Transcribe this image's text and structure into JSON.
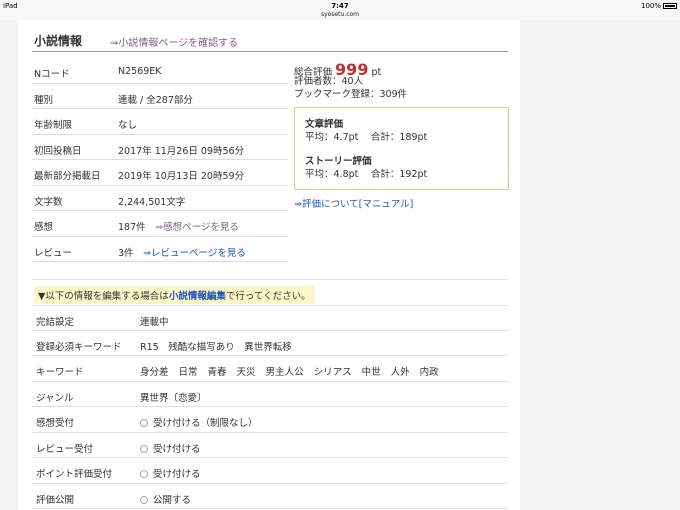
{
  "statusbar": {
    "device": "iPad",
    "time": "7:47",
    "url": "syosetu.com",
    "battery": "100%"
  },
  "header": {
    "title": "小説情報",
    "link": "⇒小説情報ページを確認する"
  },
  "info": {
    "ncode_label": "Nコード",
    "ncode": "N2569EK",
    "type_label": "種別",
    "type": "連載 / 全287部分",
    "age_label": "年齢制限",
    "age": "なし",
    "first_label": "初回投稿日",
    "first": "2017年 11月26日 09時56分",
    "latest_label": "最新部分掲載日",
    "latest": "2019年 10月13日 20時59分",
    "chars_label": "文字数",
    "chars": "2,244,501文字",
    "impressions_label": "感想",
    "impressions_count": "187件",
    "impressions_link": "⇒感想ページを見る",
    "review_label": "レビュー",
    "review_count": "3件",
    "review_link": "⇒レビューページを見る"
  },
  "stats": {
    "total_label": "総合評価",
    "total_value": "999",
    "total_unit": "pt",
    "raters": "評価者数：40人",
    "bookmarks": "ブックマーク登録：309件"
  },
  "eval": {
    "writing_title": "文章評価",
    "writing_values": "平均：4.7pt　 合計：189pt",
    "story_title": "ストーリー評価",
    "story_values": "平均：4.8pt　 合計：192pt",
    "manual_link": "⇒評価について[マニュアル]"
  },
  "edit_note": {
    "prefix": "▼以下の情報を編集する場合は",
    "link": "小説情報編集",
    "suffix": "で行ってください。"
  },
  "settings": {
    "completion_label": "完結設定",
    "completion": "連載中",
    "required_kw_label": "登録必須キーワード",
    "required_kw": "R15　残酷な描写あり　異世界転移",
    "keywords_label": "キーワード",
    "keywords": [
      "身分差",
      "日常",
      "青春",
      "天災",
      "男主人公",
      "シリアス",
      "中世",
      "人外",
      "内政"
    ],
    "genre_label": "ジャンル",
    "genre": "異世界〔恋愛〕",
    "impressions_accept_label": "感想受付",
    "impressions_accept": "受け付ける（制限なし）",
    "review_accept_label": "レビュー受付",
    "review_accept": "受け付ける",
    "point_accept_label": "ポイント評価受付",
    "point_accept": "受け付ける",
    "eval_public_label": "評価公開",
    "eval_public": "公開する"
  }
}
